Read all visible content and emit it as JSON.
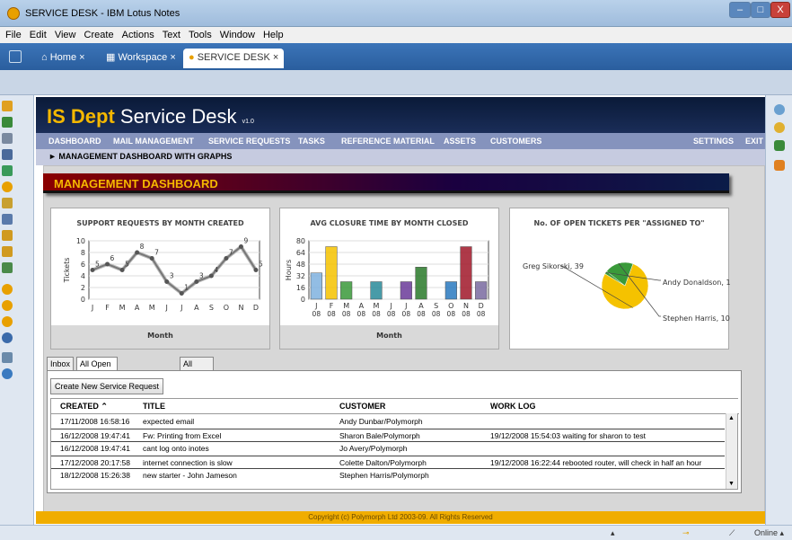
{
  "window": {
    "title": "SERVICE DESK - IBM Lotus Notes",
    "min": "–",
    "max": "□",
    "close": "X"
  },
  "menu": [
    "File",
    "Edit",
    "View",
    "Create",
    "Actions",
    "Text",
    "Tools",
    "Window",
    "Help"
  ],
  "tabs": [
    {
      "label": "Home",
      "close": "×"
    },
    {
      "label": "Workspace",
      "close": "×"
    },
    {
      "label": "SERVICE DESK",
      "close": "×"
    }
  ],
  "header": {
    "brand_bold": "IS Dept",
    "brand_rest": " Service Desk",
    "version": "v1.0"
  },
  "nav": {
    "left": [
      "DASHBOARD",
      "MAIL MANAGEMENT",
      "SERVICE REQUESTS",
      "TASKS",
      "REFERENCE MATERIAL",
      "ASSETS",
      "CUSTOMERS"
    ],
    "settings": "SETTINGS",
    "exit": "EXIT"
  },
  "breadcrumb": "► MANAGEMENT DASHBOARD WITH GRAPHS",
  "dashboard_title": "MANAGEMENT DASHBOARD",
  "chart_data": [
    {
      "type": "line",
      "title": "SUPPORT REQUESTS BY MONTH CREATED",
      "xlabel": "Month",
      "ylabel": "Tickets",
      "categories": [
        "J",
        "F",
        "M",
        "A",
        "M",
        "J",
        "J",
        "A",
        "S",
        "O",
        "N",
        "D"
      ],
      "values": [
        5,
        6,
        5,
        8,
        7,
        3,
        1,
        3,
        4,
        7,
        9,
        5
      ],
      "ylim": [
        0,
        10
      ],
      "yticks": [
        0,
        2,
        4,
        6,
        8,
        10
      ]
    },
    {
      "type": "bar",
      "title": "AVG CLOSURE TIME BY MONTH CLOSED",
      "xlabel": "Month",
      "ylabel": "Hours",
      "categories": [
        "J 08",
        "F 08",
        "M 08",
        "A 08",
        "M 08",
        "J 08",
        "J 08",
        "A 08",
        "S 08",
        "O 08",
        "N 08",
        "D 08"
      ],
      "category_months": [
        "J",
        "F",
        "M",
        "A",
        "M",
        "J",
        "J",
        "A",
        "S",
        "O",
        "N",
        "D"
      ],
      "category_year": "08",
      "values": [
        36,
        72,
        24,
        0,
        24,
        0,
        24,
        44,
        0,
        24,
        72,
        24
      ],
      "colors": [
        "#7fb2e0",
        "#f5c200",
        "#3a9a3a",
        "#3a9a3a",
        "#2a8a9a",
        "#2a8a9a",
        "#6a3a9a",
        "#2a7a2a",
        "#2a7a2a",
        "#2a7ac0",
        "#a0182a",
        "#7a6aa0"
      ],
      "ylim": [
        0,
        80
      ],
      "yticks": [
        0,
        16,
        32,
        48,
        64,
        80
      ]
    },
    {
      "type": "pie",
      "title": "No. OF OPEN TICKETS PER \"ASSIGNED TO\"",
      "slices": [
        {
          "label": "Greg Sikorski, 39",
          "value": 39,
          "color": "#f5c200"
        },
        {
          "label": "Andy Donaldson, 1",
          "value": 1,
          "color": "#3a9a3a"
        },
        {
          "label": "Stephen Harris, 10",
          "value": 10,
          "color": "#3a9a3a"
        }
      ]
    }
  ],
  "view_tabs": [
    "Inbox",
    "All Open Service Requests",
    "All Current Tasks"
  ],
  "new_button": "Create New Service Request",
  "table": {
    "headers": [
      "CREATED ⌃",
      "TITLE",
      "CUSTOMER",
      "WORK LOG"
    ],
    "rows": [
      [
        "17/11/2008 16:58:16",
        "expected email",
        "Andy Dunbar/Polymorph",
        ""
      ],
      [
        "16/12/2008 19:47:41",
        "Fw: Printing from Excel",
        "Sharon Bale/Polymorph",
        "19/12/2008 15:54:03    waiting for sharon to test"
      ],
      [
        "16/12/2008 19:47:41",
        "cant log onto inotes",
        "Jo Avery/Polymorph",
        ""
      ],
      [
        "17/12/2008 20:17:58",
        "internet connection is slow",
        "Colette Dalton/Polymorph",
        "19/12/2008 16:22:44    rebooted router, will check in half an hour"
      ],
      [
        "18/12/2008 15:26:38",
        "new starter - John Jameson",
        "Stephen Harris/Polymorph",
        ""
      ]
    ]
  },
  "footer": "Copyright (c) Polymorph Ltd 2003-09.  All Rights Reserved",
  "status": {
    "online": "Online ▴",
    "arrow": "▴"
  }
}
